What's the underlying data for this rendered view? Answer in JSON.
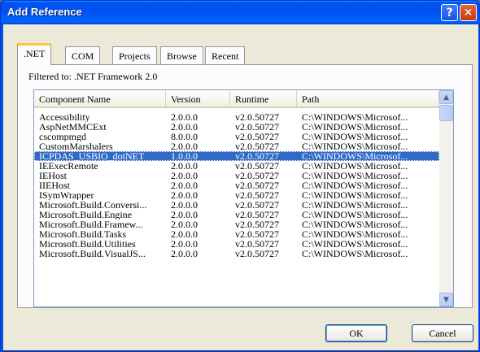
{
  "window": {
    "title": "Add Reference",
    "help_glyph": "?",
    "close_glyph": "✕"
  },
  "tabs": [
    {
      "label": ".NET",
      "active": true
    },
    {
      "label": "COM"
    },
    {
      "label": "Projects"
    },
    {
      "label": "Browse"
    },
    {
      "label": "Recent"
    }
  ],
  "filter_text": "Filtered to: .NET Framework 2.0",
  "columns": [
    "Component Name",
    "Version",
    "Runtime",
    "Path"
  ],
  "rows": [
    [
      "Accessibility",
      "2.0.0.0",
      "v2.0.50727",
      "C:\\WINDOWS\\Microsof..."
    ],
    [
      "AspNetMMCExt",
      "2.0.0.0",
      "v2.0.50727",
      "C:\\WINDOWS\\Microsof..."
    ],
    [
      "cscompmgd",
      "8.0.0.0",
      "v2.0.50727",
      "C:\\WINDOWS\\Microsof..."
    ],
    [
      "CustomMarshalers",
      "2.0.0.0",
      "v2.0.50727",
      "C:\\WINDOWS\\Microsof..."
    ],
    [
      "ICPDAS_USBIO_dotNET",
      "1.0.0.0",
      "v2.0.50727",
      "C:\\WINDOWS\\Microsof..."
    ],
    [
      "IEExecRemote",
      "2.0.0.0",
      "v2.0.50727",
      "C:\\WINDOWS\\Microsof..."
    ],
    [
      "IEHost",
      "2.0.0.0",
      "v2.0.50727",
      "C:\\WINDOWS\\Microsof..."
    ],
    [
      "IIEHost",
      "2.0.0.0",
      "v2.0.50727",
      "C:\\WINDOWS\\Microsof..."
    ],
    [
      "ISymWrapper",
      "2.0.0.0",
      "v2.0.50727",
      "C:\\WINDOWS\\Microsof..."
    ],
    [
      "Microsoft.Build.Conversi...",
      "2.0.0.0",
      "v2.0.50727",
      "C:\\WINDOWS\\Microsof..."
    ],
    [
      "Microsoft.Build.Engine",
      "2.0.0.0",
      "v2.0.50727",
      "C:\\WINDOWS\\Microsof..."
    ],
    [
      "Microsoft.Build.Framew...",
      "2.0.0.0",
      "v2.0.50727",
      "C:\\WINDOWS\\Microsof..."
    ],
    [
      "Microsoft.Build.Tasks",
      "2.0.0.0",
      "v2.0.50727",
      "C:\\WINDOWS\\Microsof..."
    ],
    [
      "Microsoft.Build.Utilities",
      "2.0.0.0",
      "v2.0.50727",
      "C:\\WINDOWS\\Microsof..."
    ],
    [
      "Microsoft.Build.VisualJS...",
      "2.0.0.0",
      "v2.0.50727",
      "C:\\WINDOWS\\Microsof..."
    ]
  ],
  "selected_row": "ICPDAS_USBIO_dotNET",
  "scrollbar": {
    "up_glyph": "▲",
    "down_glyph": "▼"
  },
  "buttons": {
    "ok": "OK",
    "cancel": "Cancel"
  },
  "colors": {
    "titlebar": "#0053ee",
    "selection": "#316ac5",
    "face": "#ece9d8"
  }
}
